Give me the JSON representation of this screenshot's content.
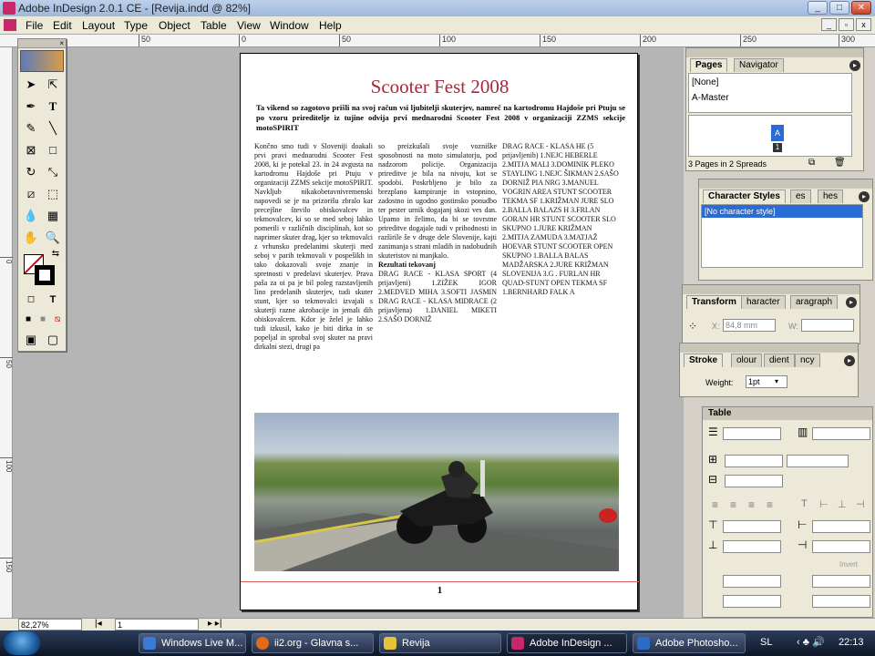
{
  "window": {
    "title": "Adobe InDesign 2.0.1 CE - [Revija.indd @ 82%]"
  },
  "menu": [
    "File",
    "Edit",
    "Layout",
    "Type",
    "Object",
    "Table",
    "View",
    "Window",
    "Help"
  ],
  "ruler": {
    "ticks": [
      "50",
      "0",
      "50",
      "100",
      "150",
      "200",
      "250",
      "300"
    ]
  },
  "vruler": {
    "ticks": [
      "0",
      "50",
      "100",
      "150",
      "200"
    ]
  },
  "document": {
    "title": "Scooter Fest 2008",
    "lead": "Ta vikend so zagotovo prišli na svoj račun vsi ljubitelji skuterjev, namreč na kartodromu Hajdoše pri Ptuju se po vzoru prireditelje iz tujine odvija prvi mednarodni Scooter Fest 2008 v organizaciji ZZMS sekcije motoSPIRIT",
    "col1": "Končno smo tudi v Sloveniji doakali prvi pravi mednarodni Scooter Fest 2008, ki je potekal 23. in 24 avgusta na kartodromu Hajdoše pri Ptuju v organizaciji ZZMS sekcije motoSPIRIT. Navkljub nikakobetavnivremenski napovedi se je na prizorišu zbralo kar precejšne število obiskovalcev in tekmovalcev, ki so se med seboj lahko pomerili v različnih disciplinah, kot so naprimer skuter drag, kjer so tekmovalci z vrhunsko predelanimi skuterji med seboj v parih tekmovali v pospešikh in tako dokazovali svoje znanje in spretnosti v predelavi skuterjev. Prava paša za oi pa je bil poleg razstavljenih lino predelanih skuterjev, tudi skuter stunt, kjer so tekmovalci izvajali s skuterji razne akrobacije in jemali dih obiskovalcem. Kdor je želel je lahko tudi izkusil, kako je biti dirka in se popeljal in sprobal svoj skuter na pravi dirkalni stezi, drugi pa",
    "col2a": "so preizkušali svoje vozniške sposobnosti na moto simulatorju, pod nadzorom policije. Organizacija prireditve je bila na nivoju, kot se spodobi. Poskrbljeno je bilo za brezplano kampiranje in vstopnino, zadostno in ugodno gostinsko ponudbo ter pester urnik dogajanj skozi ves dan. Upamo in želimo, da bi se tovrstne prireditve dogajale tudi v prihodnosti in razširile še v druge dele Slovenije, kajti zanimanja s strani mladih in nadobudnih skuteristov ni manjkalo.",
    "col2head": "Rezultati tekovanj",
    "col2b": "DRAG RACE - KLASA SPORT (4 prijavljeni) 1.ZIŽEK IGOR 2.MEDVED MIHA 3.SOFTI JASMIN DRAG RACE - KLASA MIDRACE (2 prijavljena) 1.DANIEL MIKETI 2.SAŠO DORNIŽ",
    "col3": "DRAG RACE - KLASA HE (5 prijavljenih) 1.NEJC HEBERLE 2.MITJA MALI 3.DOMINIK PLEKO STAYLING 1.NEJC ŠIKMAN 2.SAŠO DORNIŽ PIA NRG 3.MANUEL VOGRIN AREA STUNT SCOOTER TEKMA SF 1.KRIŽMAN JURE SLO 2.BALLA BALAZS H 3.FRLAN GORAN HR STUNT SCOOTER SLO SKUPNO 1.JURE KRIŽMAN 2.MITJA ZAMUDA 3.MATJAŽ HOEVAR STUNT SCOOTER OPEN SKUPNO 1.BALLA BALAS MADŽARSKA 2.JURE KRIŽMAN SLOVENIJA 3.G . FURLAN HR QUAD-STUNT OPEN TEKMA SF 1.BERNHARD FALK A",
    "page_number": "1"
  },
  "pages_panel": {
    "tabs": [
      "Pages",
      "Navigator"
    ],
    "none": "[None]",
    "master": "A-Master",
    "page_label": "A",
    "page_num": "1",
    "status": "3 Pages in 2 Spreads"
  },
  "char_panel": {
    "tabs": [
      "Character Styles",
      "es",
      "hes"
    ],
    "item": "[No character style]"
  },
  "transform_panel": {
    "tabs": [
      "Transform",
      "haracter",
      "aragraph"
    ],
    "x_label": "X:",
    "x_value": "84,8 mm",
    "w_label": "W:"
  },
  "stroke_panel": {
    "tabs": [
      "Stroke",
      "olour",
      "dient",
      "ncy"
    ],
    "weight_label": "Weight:",
    "weight_value": "1pt"
  },
  "table_panel": {
    "title": "Table",
    "invert": "Invert"
  },
  "status": {
    "zoom": "82,27%",
    "page": "1"
  },
  "taskbar": {
    "items": [
      {
        "label": "Windows Live M...",
        "color": "#3a7bd5"
      },
      {
        "label": "ii2.org - Glavna s...",
        "color": "#e06a1a"
      },
      {
        "label": "Revija",
        "color": "#e8c23a"
      },
      {
        "label": "Adobe InDesign ...",
        "color": "#c8286a"
      },
      {
        "label": "Adobe Photosho...",
        "color": "#2a6cc8"
      }
    ],
    "lang": "SL",
    "time": "22:13"
  }
}
